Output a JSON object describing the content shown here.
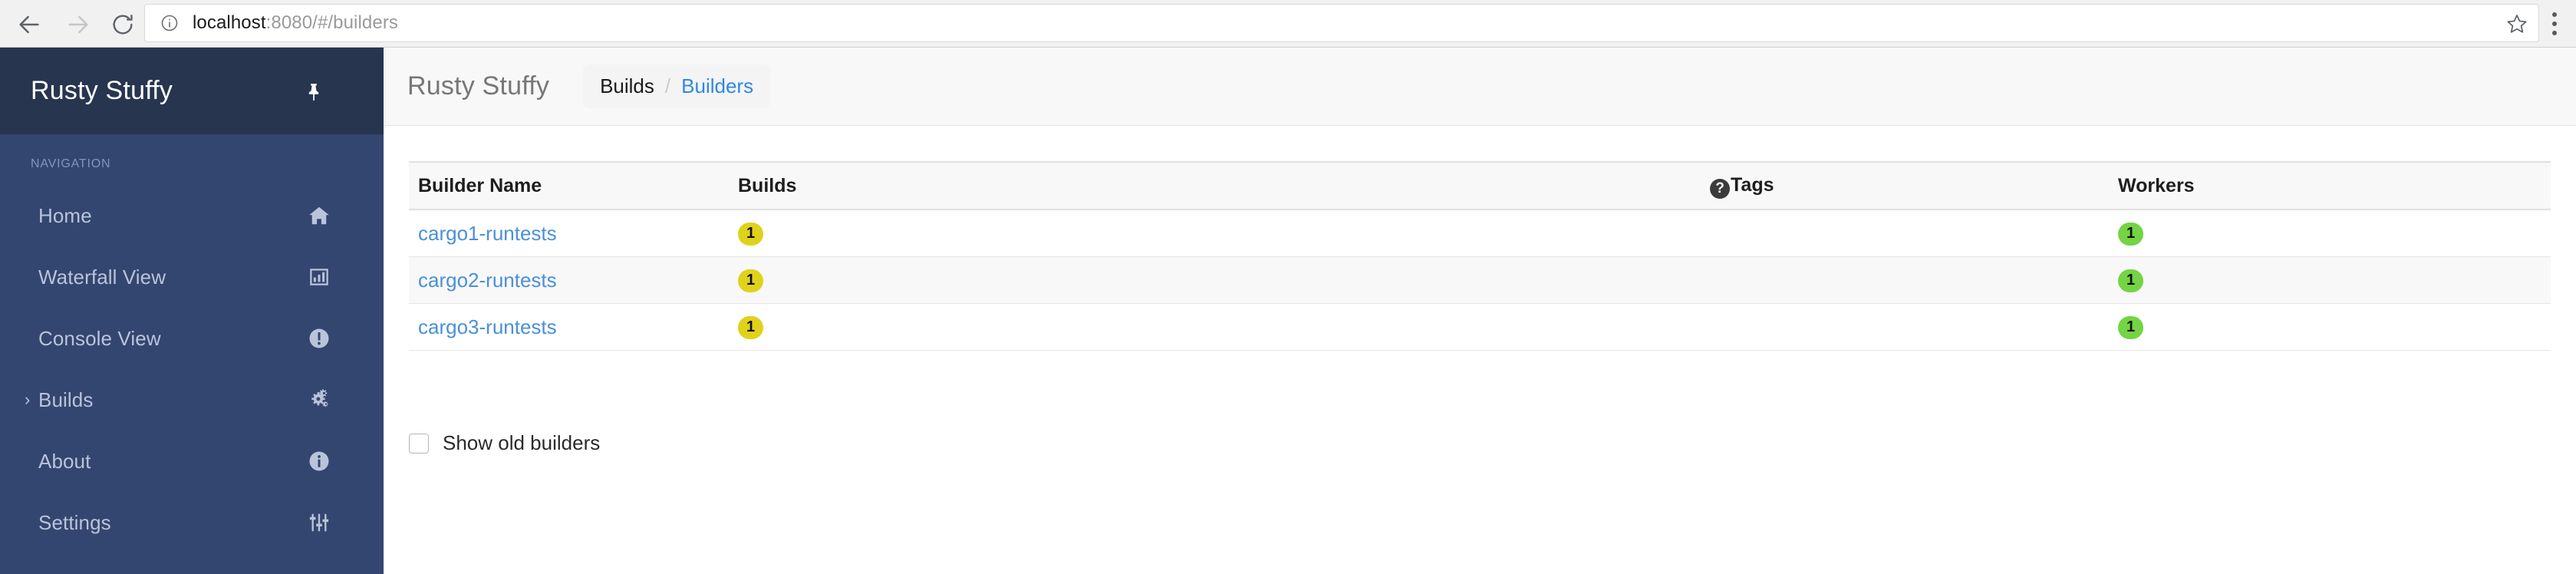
{
  "browser": {
    "back_icon": "back-arrow-icon",
    "forward_icon": "forward-arrow-icon",
    "reload_icon": "reload-icon",
    "security_icon": "info-circle-icon",
    "url_host": "localhost",
    "url_rest": ":8080/#/builders",
    "url_full": "localhost:8080/#/builders",
    "bookmark_icon": "star-icon",
    "menu_icon": "three-dot-menu-icon"
  },
  "sidebar": {
    "brand": "Rusty Stuffy",
    "pin_icon": "pin-icon",
    "section_title": "NAVIGATION",
    "items": [
      {
        "label": "Home",
        "icon": "home-icon",
        "expandable": false
      },
      {
        "label": "Waterfall View",
        "icon": "bar-chart-icon",
        "expandable": false
      },
      {
        "label": "Console View",
        "icon": "exclamation-circle-icon",
        "expandable": false
      },
      {
        "label": "Builds",
        "icon": "cogs-icon",
        "expandable": true,
        "chevron": "›"
      },
      {
        "label": "About",
        "icon": "info-circle-icon",
        "expandable": false
      },
      {
        "label": "Settings",
        "icon": "sliders-icon",
        "expandable": false
      }
    ]
  },
  "header": {
    "title": "Rusty Stuffy",
    "breadcrumb": {
      "parent": "Builds",
      "separator": "/",
      "current": "Builders"
    }
  },
  "table": {
    "columns": {
      "name": "Builder Name",
      "builds": "Builds",
      "tags": "Tags",
      "tags_help_glyph": "?",
      "workers": "Workers"
    },
    "rows": [
      {
        "name": "cargo1-runtests",
        "builds": "1",
        "tags": "",
        "workers": "1"
      },
      {
        "name": "cargo2-runtests",
        "builds": "1",
        "tags": "",
        "workers": "1"
      },
      {
        "name": "cargo3-runtests",
        "builds": "1",
        "tags": "",
        "workers": "1"
      }
    ]
  },
  "footer": {
    "show_old_builders_label": "Show old builders",
    "show_old_builders_checked": false
  },
  "colors": {
    "sidebar_header": "#27354f",
    "sidebar_body": "#334670",
    "link": "#4a90d9",
    "breadcrumb_link": "#2f87e8",
    "badge_warning": "#e0d21a",
    "badge_success": "#74d443"
  }
}
